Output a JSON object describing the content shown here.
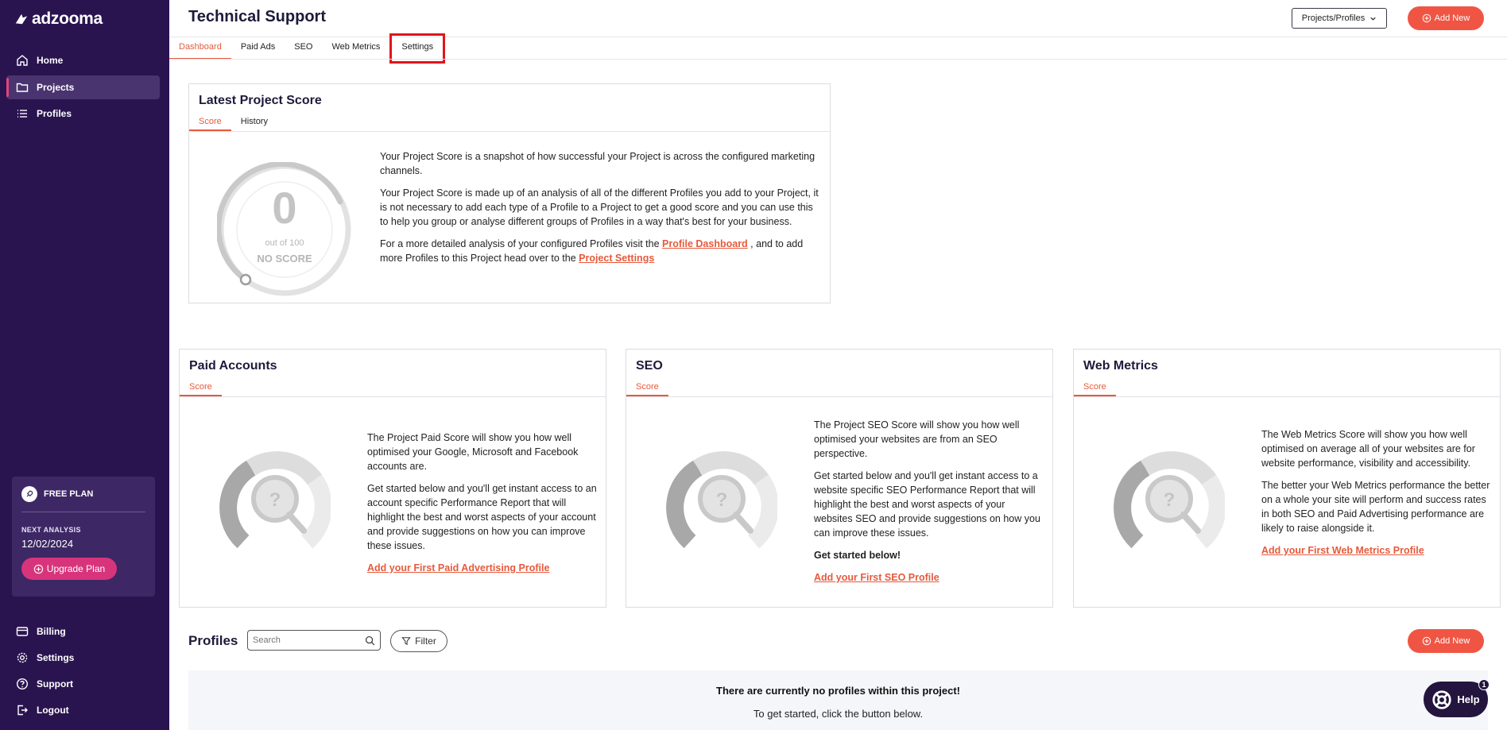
{
  "brand": {
    "name": "adzooma"
  },
  "sidebar": {
    "top_items": [
      {
        "label": "Home",
        "icon": "home-icon"
      },
      {
        "label": "Projects",
        "icon": "folder-icon",
        "active": true
      },
      {
        "label": "Profiles",
        "icon": "list-icon"
      }
    ],
    "plan": {
      "label": "FREE PLAN",
      "next_analysis_label": "NEXT ANALYSIS",
      "next_analysis_date": "12/02/2024",
      "upgrade_label": "Upgrade Plan"
    },
    "bottom_items": [
      {
        "label": "Billing",
        "icon": "billing-icon"
      },
      {
        "label": "Settings",
        "icon": "gear-icon"
      },
      {
        "label": "Support",
        "icon": "help-circle-icon"
      },
      {
        "label": "Logout",
        "icon": "logout-icon"
      }
    ]
  },
  "header": {
    "title": "Technical Support",
    "projects_profiles_label": "Projects/Profiles",
    "add_new_label": "Add New"
  },
  "tabs": [
    {
      "label": "Dashboard",
      "active": true
    },
    {
      "label": "Paid Ads"
    },
    {
      "label": "SEO"
    },
    {
      "label": "Web Metrics"
    },
    {
      "label": "Settings",
      "highlighted": true
    }
  ],
  "latest_score": {
    "title": "Latest Project Score",
    "subtabs": [
      "Score",
      "History"
    ],
    "gauge": {
      "value": "0",
      "out_of": "out of 100",
      "status": "NO SCORE"
    },
    "p1": "Your Project Score is a snapshot of how successful your Project is across the configured marketing channels.",
    "p2": "Your Project Score is made up of an analysis of all of the different Profiles you add to your Project, it is not necessary to add each type of a Profile to a Project to get a good score and you can use this to help you group or analyse different groups of Profiles in a way that's best for your business.",
    "p3_a": "For a more detailed analysis of your configured Profiles visit the ",
    "p3_link1": "Profile Dashboard",
    "p3_b": " , and to add more Profiles to this Project head over to the ",
    "p3_link2": "Project Settings"
  },
  "paid_accounts": {
    "title": "Paid Accounts",
    "subtab": "Score",
    "p1": "The Project Paid Score will show you how well optimised your Google, Microsoft and Facebook accounts are.",
    "p2": "Get started below and you'll get instant access to an account specific Performance Report that will highlight the best and worst aspects of your account and provide suggestions on how you can improve these issues.",
    "link": "Add your First Paid Advertising Profile"
  },
  "seo": {
    "title": "SEO",
    "subtab": "Score",
    "p1": "The Project SEO Score will show you how well optimised your websites are from an SEO perspective.",
    "p2": "Get started below and you'll get instant access to a website specific SEO Performance Report that will highlight the best and worst aspects of your websites SEO and provide suggestions on how you can improve these issues.",
    "p3": "Get started below!",
    "link": "Add your First SEO Profile"
  },
  "web_metrics": {
    "title": "Web Metrics",
    "subtab": "Score",
    "p1": "The Web Metrics Score will show you how well optimised on average all of your websites are for website performance, visibility and accessibility.",
    "p2": "The better your Web Metrics performance the better on a whole your site will perform and success rates in both SEO and Paid Advertising performance are likely to raise alongside it.",
    "link": "Add your First Web Metrics Profile"
  },
  "profiles": {
    "title": "Profiles",
    "search_placeholder": "Search",
    "filter_label": "Filter",
    "add_new_label": "Add New",
    "empty_title": "There are currently no profiles within this project!",
    "empty_sub": "To get started, click the button below."
  },
  "help": {
    "label": "Help",
    "badge": "1"
  },
  "colors": {
    "sidebar": "#2a1450",
    "accent": "#e65a3c",
    "add_button": "#f05544",
    "upgrade": "#d8347c"
  }
}
